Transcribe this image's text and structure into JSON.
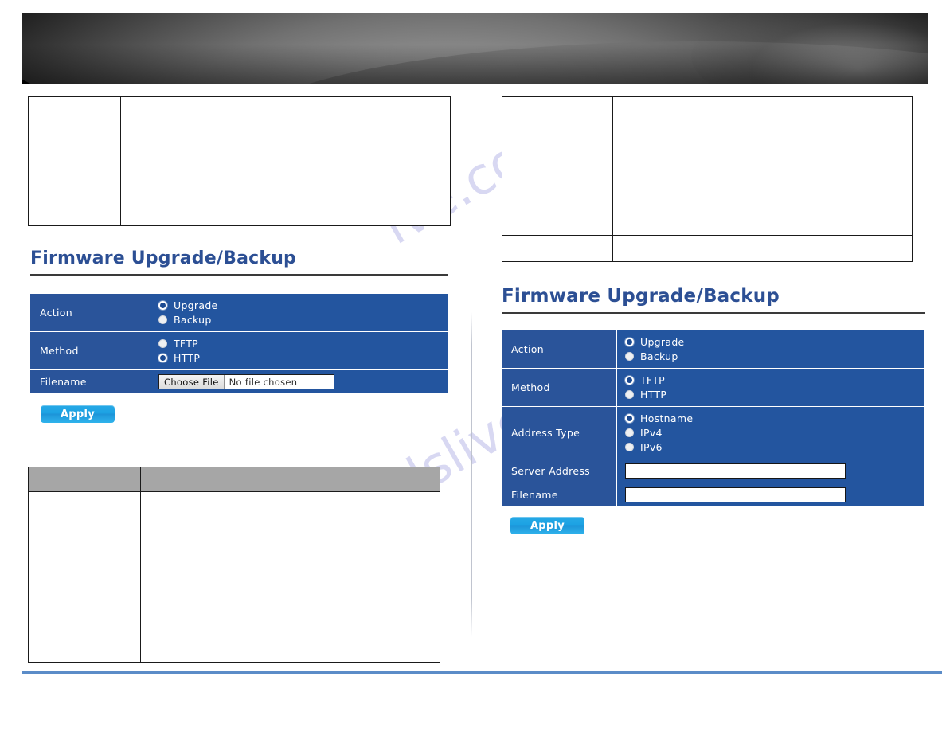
{
  "banner": {
    "name": "product-banner-image"
  },
  "watermark": {
    "line1": "manualslive",
    "line2": "ive.com"
  },
  "tables": {
    "top_left": {
      "rows": [
        [
          "",
          ""
        ],
        [
          "",
          ""
        ]
      ]
    },
    "top_right": {
      "rows": [
        [
          "",
          ""
        ],
        [
          "",
          ""
        ],
        [
          "",
          ""
        ]
      ]
    },
    "bottom_left": {
      "headers": [
        "",
        ""
      ],
      "rows": [
        [
          "",
          ""
        ],
        [
          "",
          ""
        ]
      ]
    }
  },
  "left_section": {
    "heading": "Firmware Upgrade/Backup",
    "form": {
      "rows": [
        {
          "label": "Action",
          "type": "radio",
          "options": [
            {
              "label": "Upgrade",
              "selected": true
            },
            {
              "label": "Backup",
              "selected": false
            }
          ]
        },
        {
          "label": "Method",
          "type": "radio",
          "options": [
            {
              "label": "TFTP",
              "selected": false
            },
            {
              "label": "HTTP",
              "selected": true
            }
          ]
        },
        {
          "label": "Filename",
          "type": "file",
          "button_label": "Choose File",
          "file_status": "No file chosen"
        }
      ]
    },
    "apply_label": "Apply"
  },
  "right_section": {
    "heading": "Firmware Upgrade/Backup",
    "form": {
      "rows": [
        {
          "label": "Action",
          "type": "radio",
          "options": [
            {
              "label": "Upgrade",
              "selected": true
            },
            {
              "label": "Backup",
              "selected": false
            }
          ]
        },
        {
          "label": "Method",
          "type": "radio",
          "options": [
            {
              "label": "TFTP",
              "selected": true
            },
            {
              "label": "HTTP",
              "selected": false
            }
          ]
        },
        {
          "label": "Address Type",
          "type": "radio",
          "options": [
            {
              "label": "Hostname",
              "selected": true
            },
            {
              "label": "IPv4",
              "selected": false
            },
            {
              "label": "IPv6",
              "selected": false
            }
          ]
        },
        {
          "label": "Server Address",
          "type": "text",
          "value": "",
          "placeholder": ""
        },
        {
          "label": "Filename",
          "type": "text",
          "value": "",
          "placeholder": ""
        }
      ]
    },
    "apply_label": "Apply"
  },
  "colors": {
    "heading": "#2c4f94",
    "form_label_bg": "#2a549a",
    "form_value_bg": "#23559f",
    "apply_button": "#1da2e3",
    "table_header_gray": "#a6a6a6",
    "bottom_rule": "#5b8cc8"
  }
}
